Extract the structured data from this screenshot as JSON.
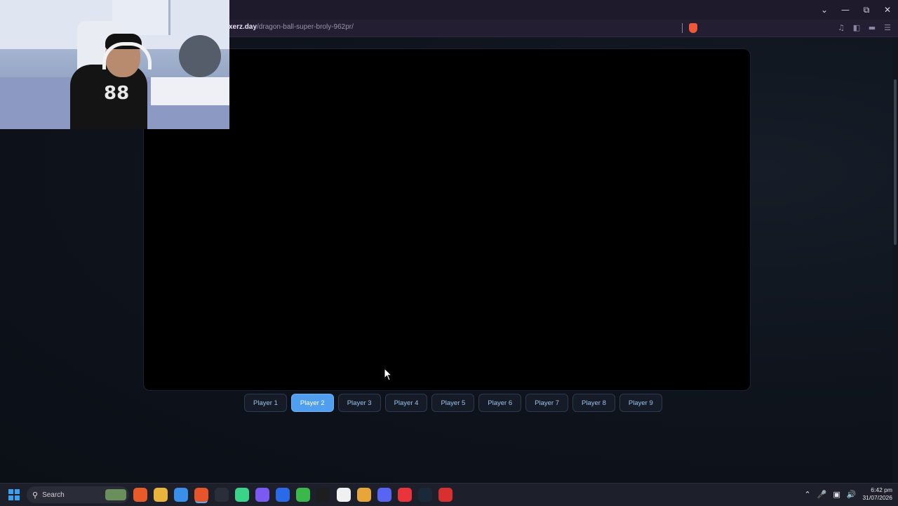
{
  "browser": {
    "url_domain": "xerz.day",
    "url_path": "/dragon-ball-super-broly-962pr/",
    "window_controls": [
      "chevron-down",
      "minimize",
      "restore",
      "close"
    ]
  },
  "player": {
    "tabs": [
      {
        "label": "Player 1",
        "active": false
      },
      {
        "label": "Player 2",
        "active": true
      },
      {
        "label": "Player 3",
        "active": false
      },
      {
        "label": "Player 4",
        "active": false
      },
      {
        "label": "Player 5",
        "active": false
      },
      {
        "label": "Player 6",
        "active": false
      },
      {
        "label": "Player 7",
        "active": false
      },
      {
        "label": "Player 8",
        "active": false
      },
      {
        "label": "Player 9",
        "active": false
      }
    ]
  },
  "taskbar": {
    "search_label": "Search",
    "apps": [
      {
        "name": "widgets-icon",
        "color": "#e85a2a",
        "active": false
      },
      {
        "name": "file-explorer-icon",
        "color": "#e8b53a",
        "active": false
      },
      {
        "name": "chrome-icon",
        "color": "#3a8fe8",
        "active": false
      },
      {
        "name": "brave-icon",
        "color": "#e8542a",
        "active": true
      },
      {
        "name": "obs-icon",
        "color": "#2a2d3a",
        "active": false
      },
      {
        "name": "app-green-icon",
        "color": "#39d48a",
        "active": false
      },
      {
        "name": "app-grid-icon",
        "color": "#7a5af0",
        "active": false
      },
      {
        "name": "ea-icon",
        "color": "#2a6ae8",
        "active": false
      },
      {
        "name": "xbox-icon",
        "color": "#3ab84a",
        "active": false
      },
      {
        "name": "capcut-icon",
        "color": "#1e1e1e",
        "active": false
      },
      {
        "name": "mail-icon",
        "color": "#f0f0f0",
        "active": false
      },
      {
        "name": "chrome-2-icon",
        "color": "#e8a53a",
        "active": false
      },
      {
        "name": "discord-icon",
        "color": "#5865f2",
        "active": false
      },
      {
        "name": "app-red-icon",
        "color": "#e8343a",
        "active": false
      },
      {
        "name": "steam-icon",
        "color": "#1b2838",
        "active": false
      },
      {
        "name": "app-triangle-icon",
        "color": "#d83030",
        "active": false
      }
    ],
    "time": "6:42 pm",
    "date": "31/07/2026"
  }
}
